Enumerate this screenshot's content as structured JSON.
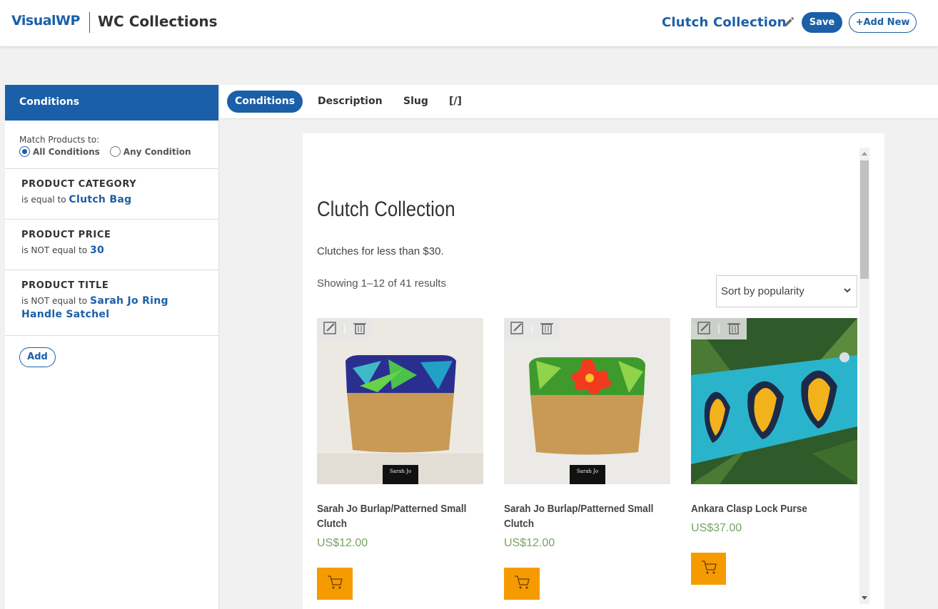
{
  "header": {
    "brand": "VisualWP",
    "app_title": "WC Collections",
    "collection_name": "Clutch Collection",
    "save_label": "Save",
    "add_new_label": "+Add New"
  },
  "sidebar": {
    "heading": "Conditions",
    "match_label": "Match Products to:",
    "options": [
      "All Conditions",
      "Any Condition"
    ],
    "selected_option": "All Conditions",
    "conditions": [
      {
        "name": "PRODUCT CATEGORY",
        "operator": "is equal to",
        "value": "Clutch Bag"
      },
      {
        "name": "PRODUCT PRICE",
        "operator": "is NOT equal to",
        "value": "30"
      },
      {
        "name": "PRODUCT TITLE",
        "operator": "is NOT equal to",
        "value": "Sarah Jo Ring Handle Satchel"
      }
    ],
    "add_label": "Add"
  },
  "tabs": [
    {
      "label": "Conditions",
      "active": true
    },
    {
      "label": "Description",
      "active": false
    },
    {
      "label": "Slug",
      "active": false
    },
    {
      "label": "[/]",
      "active": false
    }
  ],
  "preview": {
    "title": "Clutch Collection",
    "description": "Clutches for less than $30.",
    "result_count": "Showing 1–12 of 41 results",
    "sort_selected": "Sort by popularity",
    "products": [
      {
        "name": "Sarah Jo Burlap/Patterned Small Clutch",
        "price": "US$12.00",
        "logo_text": "Sarah Jo",
        "image_icon": "blue-leaf-burlap-clutch"
      },
      {
        "name": "Sarah Jo Burlap/Patterned Small Clutch",
        "price": "US$12.00",
        "logo_text": "Sarah Jo",
        "image_icon": "hibiscus-burlap-clutch"
      },
      {
        "name": "Ankara Clasp Lock Purse",
        "price": "US$37.00",
        "image_icon": "ankara-print-purse"
      }
    ]
  },
  "colors": {
    "brand_blue": "#1b5fa8",
    "price_green": "#77a464",
    "cart_orange": "#f59b00"
  }
}
